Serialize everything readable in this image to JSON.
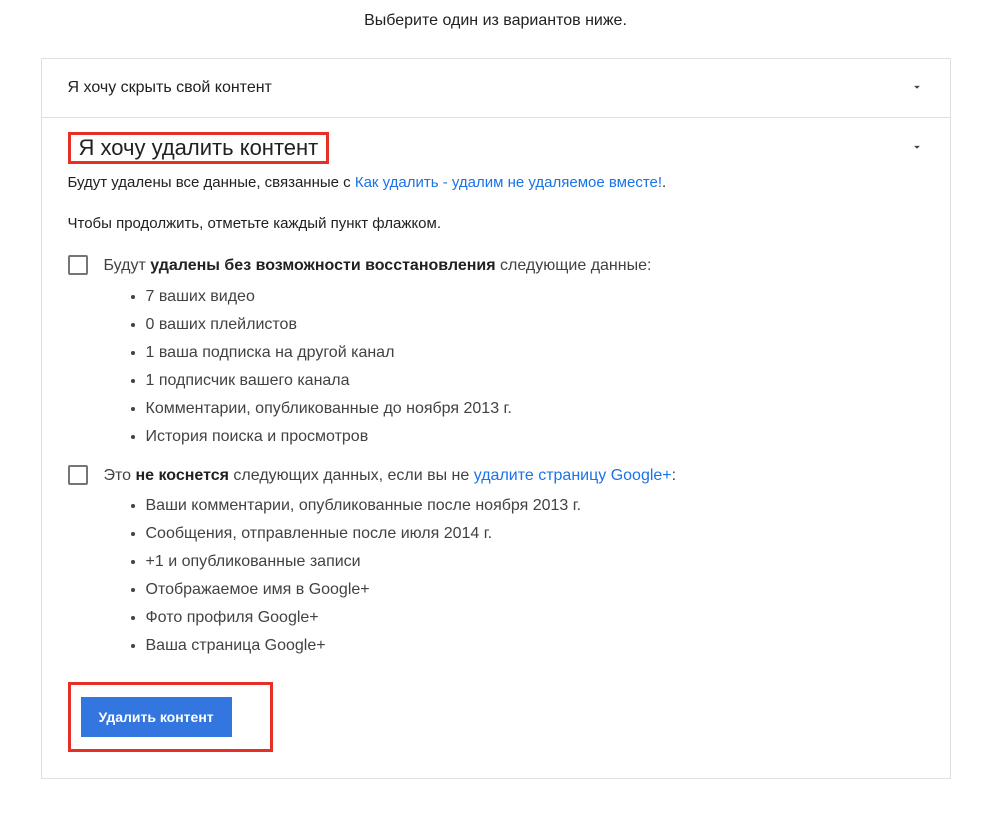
{
  "intro": "Выберите один из вариантов ниже.",
  "section_hide": {
    "title": "Я хочу скрыть свой контент"
  },
  "section_delete": {
    "title": "Я хочу удалить контент",
    "line1_prefix": "Будут удалены все данные, связанные с ",
    "line1_link": "Как удалить - удалим не удаляемое вместе!",
    "line1_suffix": ".",
    "line2": "Чтобы продолжить, отметьте каждый пункт флажком.",
    "check1": {
      "prefix": "Будут ",
      "bold": "удалены без возможности восстановления",
      "suffix": " следующие данные:",
      "items": [
        "7 ваших видео",
        "0 ваших плейлистов",
        "1 ваша подписка на другой канал",
        "1 подписчик вашего канала",
        "Комментарии, опубликованные до ноября 2013 г.",
        "История поиска и просмотров"
      ]
    },
    "check2": {
      "prefix": "Это ",
      "bold": "не коснется",
      "mid": " следующих данных, если вы не ",
      "link": "удалите страницу Google+",
      "suffix": ":",
      "items": [
        "Ваши комментарии, опубликованные после ноября 2013 г.",
        "Сообщения, отправленные после июля 2014 г.",
        "+1 и опубликованные записи",
        "Отображаемое имя в Google+",
        "Фото профиля Google+",
        "Ваша страница Google+"
      ]
    },
    "button": "Удалить контент"
  }
}
